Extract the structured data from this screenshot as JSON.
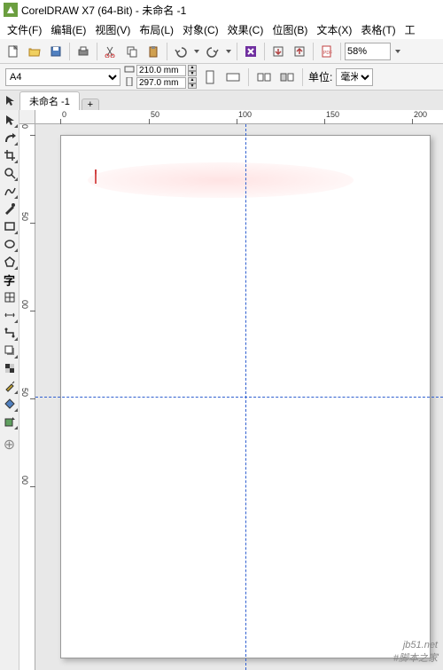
{
  "title": "CorelDRAW X7 (64-Bit) - 未命名 -1",
  "menu": {
    "file": "文件(F)",
    "edit": "编辑(E)",
    "view": "视图(V)",
    "layout": "布局(L)",
    "object": "对象(C)",
    "effects": "效果(C)",
    "bitmaps": "位图(B)",
    "text": "文本(X)",
    "table": "表格(T)",
    "tools": "工"
  },
  "toolbar": {
    "zoom": "58%"
  },
  "property": {
    "page_size": "A4",
    "width": "210.0 mm",
    "height": "297.0 mm",
    "units_label": "单位:",
    "units_value": "毫米"
  },
  "tabs": {
    "doc1": "未命名 -1",
    "add": "+"
  },
  "rulers": {
    "h": [
      "0",
      "50",
      "100",
      "150",
      "200"
    ],
    "v": [
      "0",
      "50",
      "00",
      "50",
      "00"
    ]
  },
  "watermark": "jb51.net\n#脚本之家"
}
